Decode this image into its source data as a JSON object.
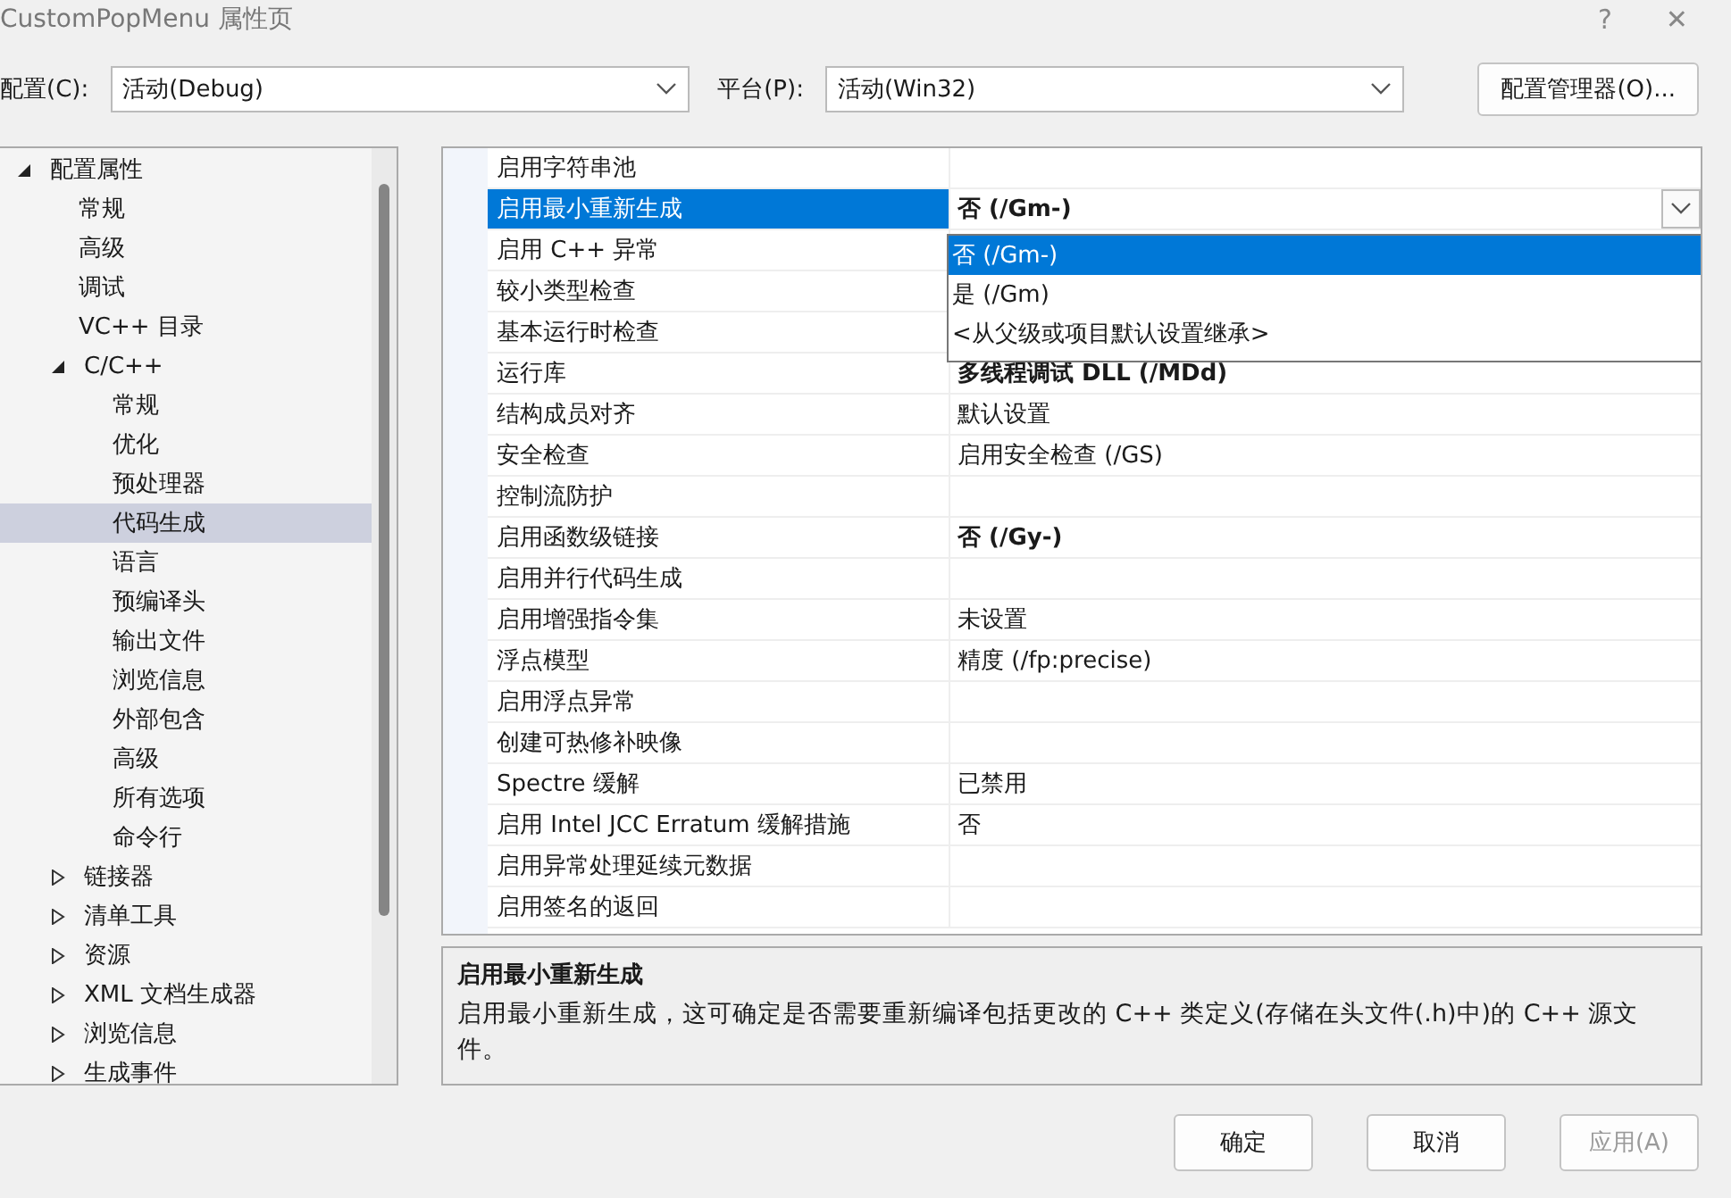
{
  "window": {
    "title": "CustomPopMenu 属性页",
    "help": "?",
    "close": "✕"
  },
  "config": {
    "label": "配置(C):",
    "value": "活动(Debug)"
  },
  "platform": {
    "label": "平台(P):",
    "value": "活动(Win32)"
  },
  "config_manager": "配置管理器(O)...",
  "tree": [
    {
      "label": "配置属性",
      "expanded": true,
      "selected": false,
      "children": [
        {
          "label": "常规",
          "selected": false
        },
        {
          "label": "高级",
          "selected": false
        },
        {
          "label": "调试",
          "selected": false
        },
        {
          "label": "VC++ 目录",
          "selected": false
        },
        {
          "label": "C/C++",
          "expanded": true,
          "selected": false,
          "children": [
            {
              "label": "常规",
              "selected": false
            },
            {
              "label": "优化",
              "selected": false
            },
            {
              "label": "预处理器",
              "selected": false
            },
            {
              "label": "代码生成",
              "selected": true
            },
            {
              "label": "语言",
              "selected": false
            },
            {
              "label": "预编译头",
              "selected": false
            },
            {
              "label": "输出文件",
              "selected": false
            },
            {
              "label": "浏览信息",
              "selected": false
            },
            {
              "label": "外部包含",
              "selected": false
            },
            {
              "label": "高级",
              "selected": false
            },
            {
              "label": "所有选项",
              "selected": false
            },
            {
              "label": "命令行",
              "selected": false
            }
          ]
        },
        {
          "label": "链接器",
          "expanded": false,
          "selected": false
        },
        {
          "label": "清单工具",
          "expanded": false,
          "selected": false
        },
        {
          "label": "资源",
          "expanded": false,
          "selected": false
        },
        {
          "label": "XML 文档生成器",
          "expanded": false,
          "selected": false
        },
        {
          "label": "浏览信息",
          "expanded": false,
          "selected": false
        },
        {
          "label": "生成事件",
          "expanded": false,
          "selected": false
        }
      ]
    }
  ],
  "properties": [
    {
      "name": "启用字符串池",
      "selected": false
    },
    {
      "name": "启用最小重新生成",
      "value": "否 (/Gm-)",
      "bold": true,
      "selected": true
    },
    {
      "name": "启用 C++ 异常",
      "selected": false
    },
    {
      "name": "较小类型检查",
      "selected": false
    },
    {
      "name": "基本运行时检查",
      "selected": false
    },
    {
      "name": "运行库",
      "value": "多线程调试 DLL (/MDd)",
      "bold": true,
      "selected": false
    },
    {
      "name": "结构成员对齐",
      "value": "默认设置",
      "bold": false,
      "selected": false
    },
    {
      "name": "安全检查",
      "value": "启用安全检查 (/GS)",
      "bold": false,
      "selected": false
    },
    {
      "name": "控制流防护",
      "selected": false
    },
    {
      "name": "启用函数级链接",
      "value": "否 (/Gy-)",
      "bold": true,
      "selected": false
    },
    {
      "name": "启用并行代码生成",
      "selected": false
    },
    {
      "name": "启用增强指令集",
      "value": "未设置",
      "bold": false,
      "selected": false
    },
    {
      "name": "浮点模型",
      "value": "精度 (/fp:precise)",
      "bold": false,
      "selected": false
    },
    {
      "name": "启用浮点异常",
      "selected": false
    },
    {
      "name": "创建可热修补映像",
      "selected": false
    },
    {
      "name": "Spectre 缓解",
      "value": "已禁用",
      "bold": false,
      "selected": false
    },
    {
      "name": "启用 Intel JCC Erratum 缓解措施",
      "value": "否",
      "bold": false,
      "selected": false
    },
    {
      "name": "启用异常处理延续元数据",
      "selected": false
    },
    {
      "name": "启用签名的返回",
      "selected": false
    }
  ],
  "dropdown_options": [
    {
      "label": "否 (/Gm-)",
      "selected": true
    },
    {
      "label": "是 (/Gm)",
      "selected": false
    },
    {
      "label": "<从父级或项目默认设置继承>",
      "selected": false
    }
  ],
  "description": {
    "title": "启用最小重新生成",
    "text": "启用最小重新生成，这可确定是否需要重新编译包括更改的 C++ 类定义(存储在头文件(.h)中)的 C++ 源文件。"
  },
  "buttons": [
    {
      "label": "确定",
      "disabled": false
    },
    {
      "label": "取消",
      "disabled": false
    },
    {
      "label": "应用(A)",
      "disabled": true
    }
  ]
}
